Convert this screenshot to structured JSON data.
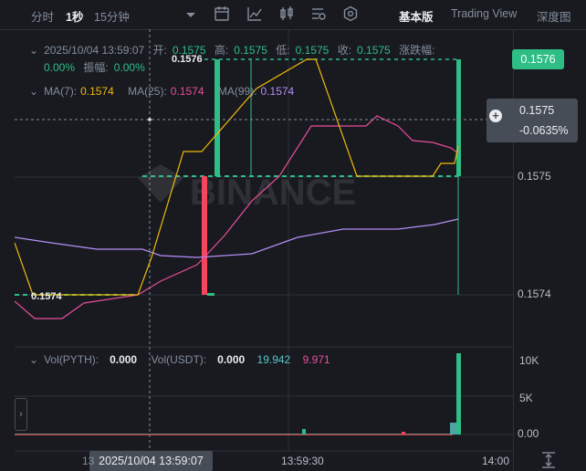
{
  "toolbar": {
    "interval_time": "分时",
    "interval_1s": "1秒",
    "interval_15m": "15分钟",
    "view_basic": "基本版",
    "view_tradingview": "Trading View",
    "view_depth": "深度图"
  },
  "legend": {
    "datetime": "2025/10/04 13:59:07",
    "open_label": "开:",
    "open": "0.1575",
    "high_label": "高:",
    "high": "0.1575",
    "low_label": "低:",
    "low": "0.1575",
    "close_label": "收:",
    "close": "0.1575",
    "change_label": "涨跌幅:",
    "change": "0.00%",
    "amp_label": "振幅:",
    "amp": "0.00%",
    "ma7_label": "MA(7):",
    "ma7": "0.1574",
    "ma25_label": "MA(25):",
    "ma25": "0.1574",
    "ma99_label": "MA(99):",
    "ma99": "0.1574"
  },
  "price_axis": {
    "last_price": "0.1576",
    "cross_price": "0.1575",
    "cross_change": "-0.0635%",
    "tick_0": "0.1575",
    "tick_1": "0.1574"
  },
  "chart_marks": {
    "high_mark": "0.1576",
    "low_mark": "0.1574"
  },
  "volume": {
    "pyth_label": "Vol(PYTH):",
    "pyth": "0.000",
    "usdt_label": "Vol(USDT):",
    "usdt": "0.000",
    "v1": "19.942",
    "v2": "9.971",
    "tick_10k": "10K",
    "tick_5k": "5K",
    "tick_0": "0.00"
  },
  "time_axis": {
    "cross_time": "2025/10/04 13:59:07",
    "t1": "13:59:30",
    "t2": "14:00"
  },
  "watermark": "BINANCE",
  "colors": {
    "up": "#2ebd85",
    "down": "#f6465d",
    "ma7": "#f0b90b",
    "ma25": "#e84e9b",
    "ma99": "#b68ef5",
    "bg": "#181a20"
  }
}
